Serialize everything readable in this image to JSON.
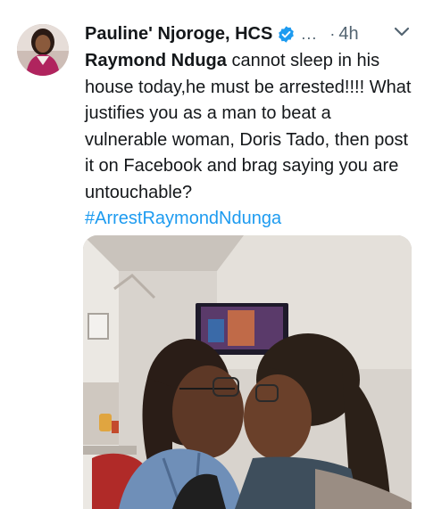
{
  "tweet": {
    "author_name": "Pauline' Njoroge, HCS",
    "ellipsis": "...",
    "separator": "·",
    "time": "4h",
    "mention": "Raymond Nduga",
    "text": " cannot sleep in his house today,he must be arrested!!!! What justifies you as a man to beat a vulnerable woman, Doris Tado, then post it on Facebook and brag saying you are untouchable?",
    "hashtag": "#ArrestRaymondNdunga"
  },
  "colors": {
    "accent": "#1d9bf0",
    "secondary_text": "#536471",
    "primary_text": "#14171a"
  },
  "icons": {
    "verified": "verified-badge-icon",
    "more": "chevron-down-icon"
  }
}
